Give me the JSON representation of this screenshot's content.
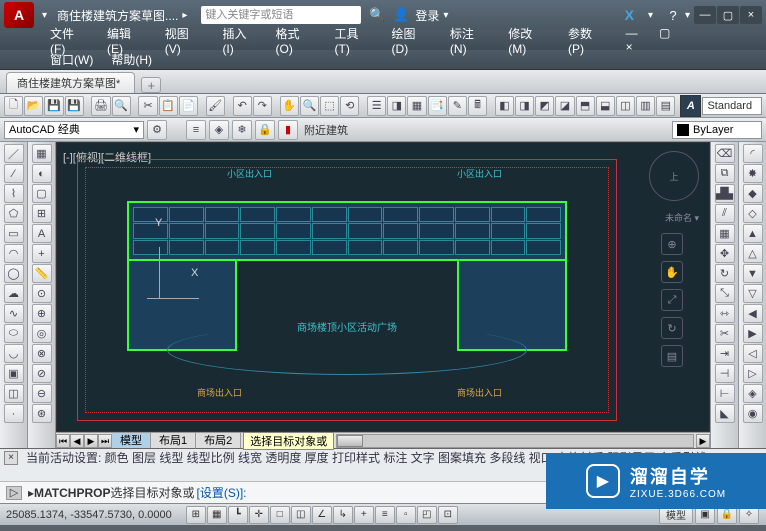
{
  "titlebar": {
    "logo_text": "A",
    "doc_title": "商住楼建筑方案草图....",
    "search_placeholder": "键入关键字或短语",
    "login_label": "登录",
    "help_icon": "?",
    "x_extension": "X",
    "min": "—",
    "restore": "▢",
    "close": "×"
  },
  "menubar": {
    "items": [
      "文件(F)",
      "编辑(E)",
      "视图(V)",
      "插入(I)",
      "格式(O)",
      "工具(T)",
      "绘图(D)",
      "标注(N)",
      "修改(M)",
      "参数(P)"
    ],
    "row2": [
      "窗口(W)",
      "帮助(H)"
    ]
  },
  "filetab": {
    "name": "商住楼建筑方案草图*",
    "new": "+"
  },
  "toolbar1": {
    "style_icon": "A",
    "style_value": "Standard"
  },
  "toolbar2": {
    "workspace": "AutoCAD 经典",
    "nearby_label": "附近建筑",
    "layer_value": "ByLayer"
  },
  "canvas": {
    "viewport_label": "[-][俯视][二维线框]",
    "entrance_a": "小区出入口",
    "entrance_b": "小区出入口",
    "plaza_text": "商场楼顶小区活动广场",
    "shop_a": "商场出入口",
    "shop_b": "商场出入口",
    "viewcube_top": "上",
    "unnamed": "未命名 ▾",
    "ucs_y": "Y",
    "ucs_x": "X"
  },
  "model_tabs": {
    "model": "模型",
    "layout1": "布局1",
    "layout2": "布局2",
    "tooltip": "选择目标对象或"
  },
  "command": {
    "history_line1": "当前活动设置:  颜色 图层 线型 线型比例 线宽 透明度 厚度 打印样式 标注 文字 图案填充 多段线 视口 表格材质 阴影显示 多重引线",
    "history_line2": "",
    "prompt_prefix": "MATCHPROP",
    "prompt_text": " 选择目标对象或 ",
    "settings_link": "[设置(S)]:"
  },
  "statusbar": {
    "coords": "25085.1374, -33547.5730, 0.0000",
    "right_model": "模型"
  },
  "watermark": {
    "brand": "溜溜自学",
    "url": "ZIXUE.3D66.COM"
  }
}
